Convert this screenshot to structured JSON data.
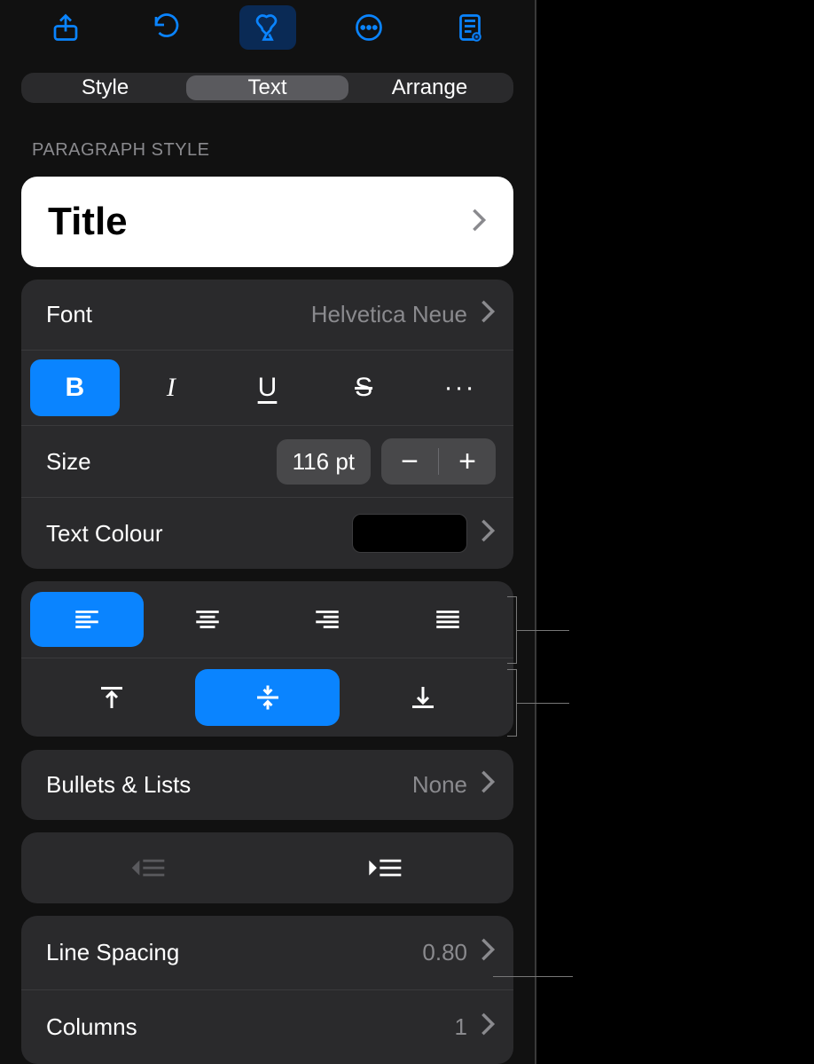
{
  "tabs": {
    "style": "Style",
    "text": "Text",
    "arrange": "Arrange"
  },
  "section": {
    "paragraph_style": "PARAGRAPH STYLE"
  },
  "paragraph_style": {
    "name": "Title"
  },
  "font": {
    "label": "Font",
    "value": "Helvetica Neue"
  },
  "style_buttons": {
    "bold": "B",
    "italic": "I",
    "underline": "U",
    "strike": "S",
    "more": "···"
  },
  "size": {
    "label": "Size",
    "value": "116 pt",
    "minus": "−",
    "plus": "+"
  },
  "text_colour": {
    "label": "Text Colour",
    "value_hex": "#000000"
  },
  "bullets": {
    "label": "Bullets & Lists",
    "value": "None"
  },
  "line_spacing": {
    "label": "Line Spacing",
    "value": "0.80"
  },
  "columns": {
    "label": "Columns",
    "value": "1"
  }
}
